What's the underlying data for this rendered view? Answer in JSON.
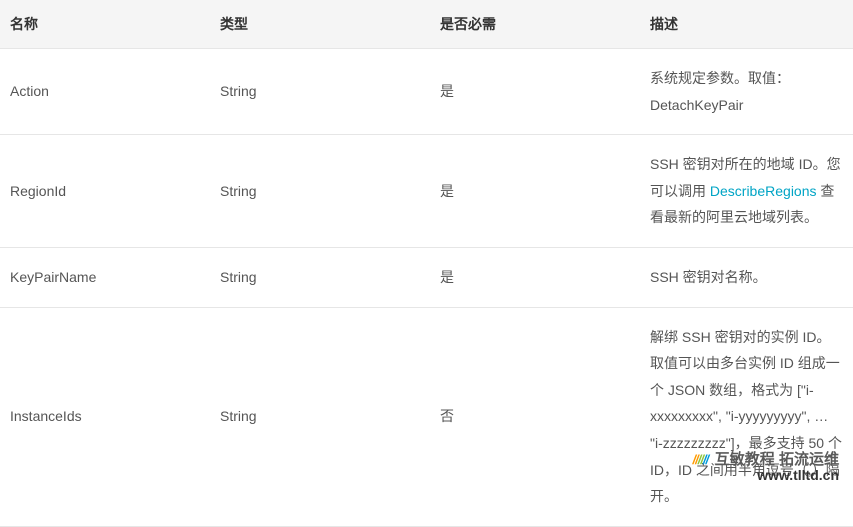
{
  "table": {
    "headers": [
      "名称",
      "类型",
      "是否必需",
      "描述"
    ],
    "rows": [
      {
        "name": "Action",
        "type": "String",
        "required": "是",
        "desc_parts": [
          "系统规定参数。取值：DetachKeyPair"
        ]
      },
      {
        "name": "RegionId",
        "type": "String",
        "required": "是",
        "desc_parts": [
          "SSH 密钥对所在的地域 ID。您可以调用 ",
          {
            "link": "DescribeRegions"
          },
          " 查看最新的阿里云地域列表。"
        ]
      },
      {
        "name": "KeyPairName",
        "type": "String",
        "required": "是",
        "desc_parts": [
          "SSH 密钥对名称。"
        ]
      },
      {
        "name": "InstanceIds",
        "type": "String",
        "required": "否",
        "desc_parts": [
          "解绑 SSH 密钥对的实例 ID。取值可以由多台实例 ID 组成一个 JSON 数组，格式为 [\"i-xxxxxxxxx\", \"i-yyyyyyyyy\", … \"i-zzzzzzzzz\"]，最多支持 50 个 ID，ID 之间用半角逗号（,）隔开。"
        ]
      }
    ]
  },
  "watermark": {
    "brand_a": "互敏教程",
    "brand_b": "拓流运维",
    "url": "www.tlltd.cn"
  }
}
